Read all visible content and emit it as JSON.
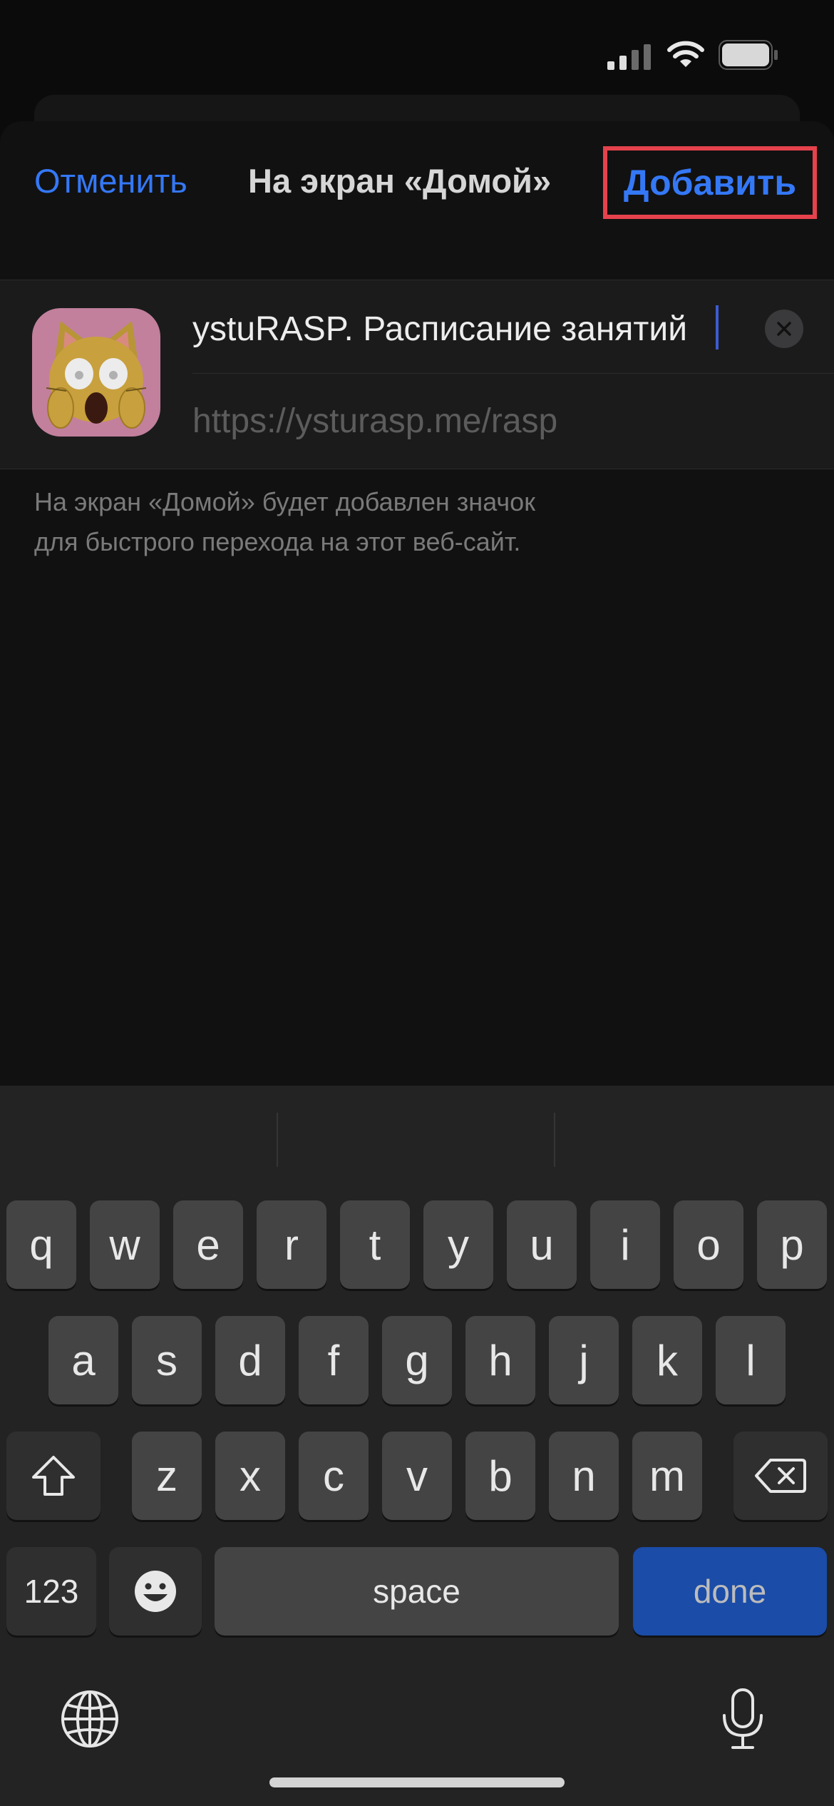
{
  "header": {
    "cancel_label": "Отменить",
    "title": "На экран «Домой»",
    "add_label": "Добавить"
  },
  "bookmark": {
    "name_value": "ystuRASP. Расписание занятий",
    "url": "https://ysturasp.me/rasp",
    "icon": "scared-cat-emoji-icon",
    "icon_bg_color": "#c2809d"
  },
  "hint": {
    "line1": "На экран «Домой» будет добавлен значок",
    "line2": "для быстрого перехода на этот веб-сайт."
  },
  "keyboard": {
    "row1": [
      "q",
      "w",
      "e",
      "r",
      "t",
      "y",
      "u",
      "i",
      "o",
      "p"
    ],
    "row2": [
      "a",
      "s",
      "d",
      "f",
      "g",
      "h",
      "j",
      "k",
      "l"
    ],
    "row3": [
      "z",
      "x",
      "c",
      "v",
      "b",
      "n",
      "m"
    ],
    "numbers_label": "123",
    "space_label": "space",
    "done_label": "done"
  },
  "colors": {
    "accent": "#3478f6",
    "highlight_border": "#e5424c",
    "done_key": "#1a4ca8"
  }
}
